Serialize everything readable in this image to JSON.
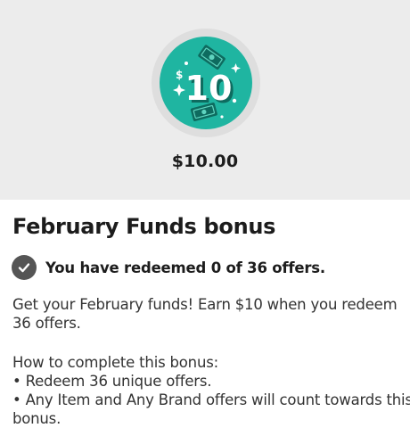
{
  "reward": {
    "badge_icon": "ten-dollar-bill-badge-icon",
    "badge_text": "10",
    "badge_currency": "$",
    "amount": "$10.00",
    "badge_color": "#1fb5a1"
  },
  "bonus": {
    "title": "February Funds bonus",
    "status_icon": "checkmark-circle-icon",
    "status": "You have redeemed 0 of 36 offers.",
    "description": "Get your February funds! Earn $10 when you redeem 36 offers.",
    "howto_heading": "How to complete this bonus:",
    "howto_items": [
      "• Redeem 36 unique offers.",
      "• Any Item and Any Brand offers will count towards this",
      "bonus."
    ]
  }
}
